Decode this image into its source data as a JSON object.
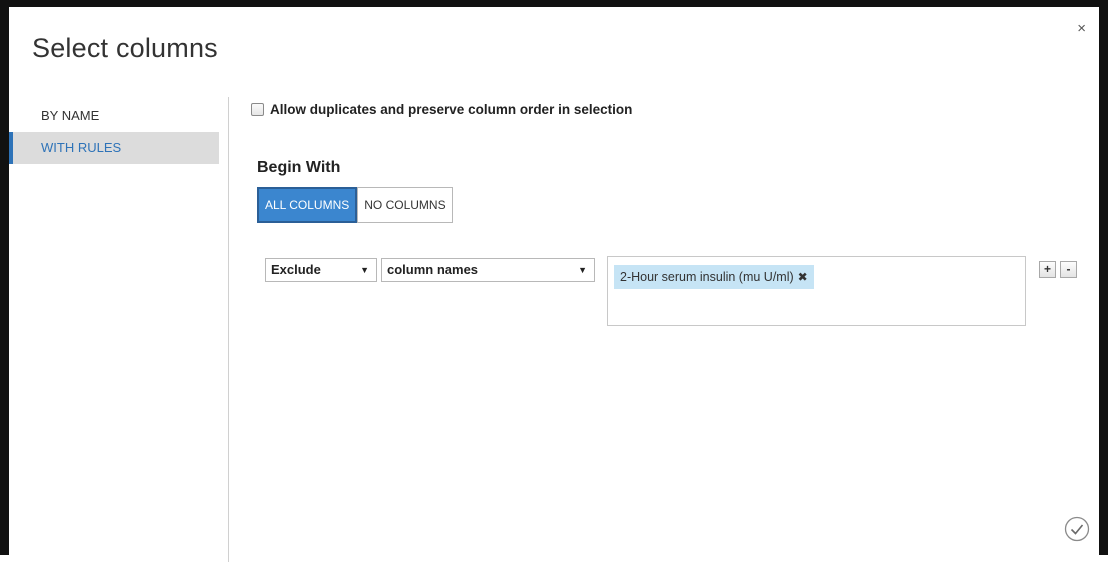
{
  "dialog": {
    "title": "Select columns",
    "close_glyph": "×"
  },
  "sidebar": {
    "items": [
      {
        "label": "BY NAME",
        "active": false
      },
      {
        "label": "WITH RULES",
        "active": true
      }
    ]
  },
  "options": {
    "allow_duplicates_label": "Allow duplicates and preserve column order in selection",
    "allow_duplicates_checked": false
  },
  "begin_with": {
    "title": "Begin With",
    "buttons": [
      {
        "label": "ALL COLUMNS",
        "selected": true
      },
      {
        "label": "NO COLUMNS",
        "selected": false
      }
    ]
  },
  "rule": {
    "action_value": "Exclude",
    "type_value": "column names",
    "tags": [
      {
        "label": "2-Hour serum insulin (mu U/ml)",
        "remove_glyph": "✖"
      }
    ],
    "add_label": "+",
    "remove_label": "-"
  },
  "colors": {
    "accent": "#3b86cf",
    "tag_bg": "#c6e4f5",
    "active_tab_text": "#2e73b8"
  },
  "icons": {
    "close": "close-icon",
    "ok": "check-circle-icon",
    "dropdown": "chevron-down-icon"
  }
}
